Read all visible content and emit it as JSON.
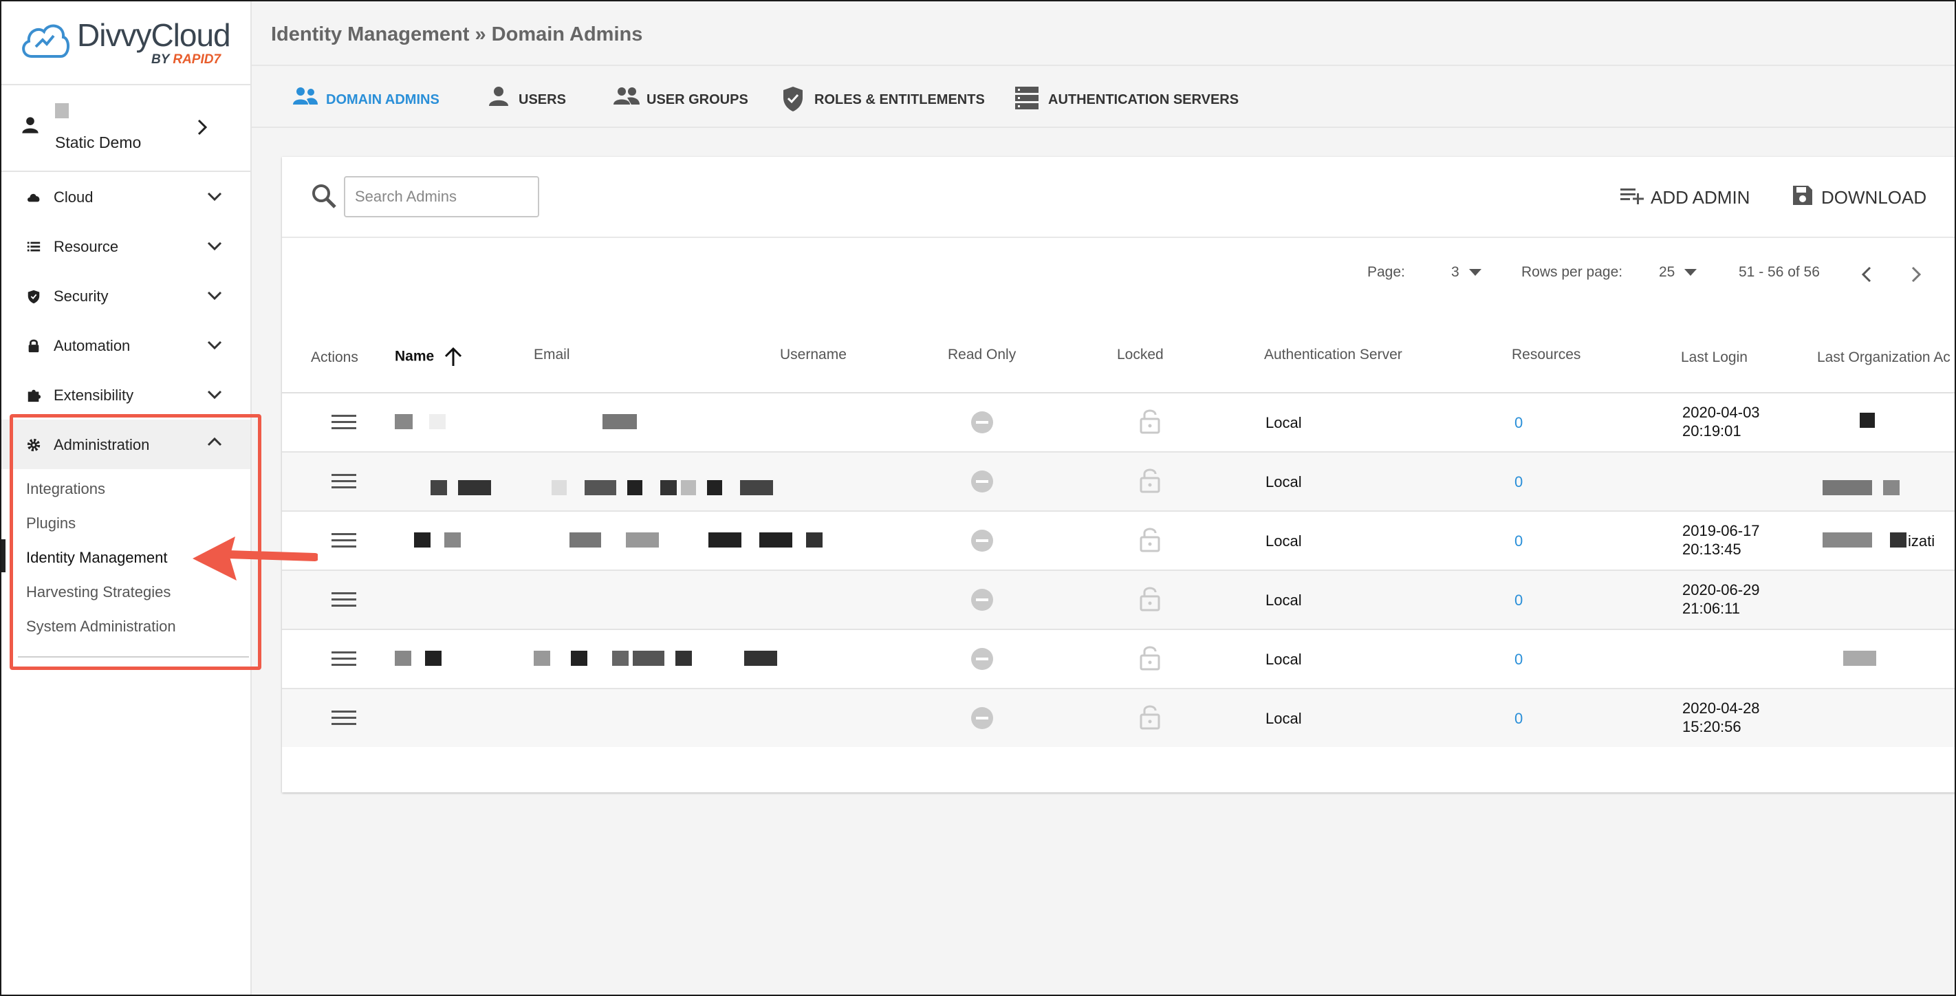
{
  "app": {
    "brand": "DivvyCloud",
    "by": "BY",
    "by_brand": "RAPID7"
  },
  "user": {
    "name": "Static Demo"
  },
  "nav": [
    {
      "label": "Cloud",
      "icon": "cloud-icon"
    },
    {
      "label": "Resource",
      "icon": "list-icon"
    },
    {
      "label": "Security",
      "icon": "shield-icon"
    },
    {
      "label": "Automation",
      "icon": "lock-icon"
    },
    {
      "label": "Extensibility",
      "icon": "puzzle-icon"
    },
    {
      "label": "Administration",
      "icon": "gear-icon",
      "expanded": true
    }
  ],
  "admin_sub": [
    "Integrations",
    "Plugins",
    "Identity Management",
    "Harvesting Strategies",
    "System Administration"
  ],
  "header": {
    "breadcrumb": "Identity Management » Domain Admins"
  },
  "tabs": [
    "DOMAIN ADMINS",
    "USERS",
    "USER GROUPS",
    "ROLES & ENTITLEMENTS",
    "AUTHENTICATION SERVERS"
  ],
  "toolbar": {
    "search_placeholder": "Search Admins",
    "add_label": "ADD ADMIN",
    "download_label": "DOWNLOAD"
  },
  "pager": {
    "page_label": "Page:",
    "page": "3",
    "rows_label": "Rows per page:",
    "rows": "25",
    "range": "51 - 56 of 56"
  },
  "columns": [
    "Actions",
    "Name",
    "Email",
    "Username",
    "Read Only",
    "Locked",
    "Authentication Server",
    "Resources",
    "Last Login",
    "Last Organization Ac"
  ],
  "rows": [
    {
      "auth": "Local",
      "resources": "0",
      "login_date": "2020-04-03",
      "login_time": "20:19:01",
      "org": ""
    },
    {
      "auth": "Local",
      "resources": "0",
      "login_date": "",
      "login_time": "",
      "org": ""
    },
    {
      "auth": "Local",
      "resources": "0",
      "login_date": "2019-06-17",
      "login_time": "20:13:45",
      "org": "izati"
    },
    {
      "auth": "Local",
      "resources": "0",
      "login_date": "2020-06-29",
      "login_time": "21:06:11",
      "org": ""
    },
    {
      "auth": "Local",
      "resources": "0",
      "login_date": "",
      "login_time": "",
      "org": ""
    },
    {
      "auth": "Local",
      "resources": "0",
      "login_date": "2020-04-28",
      "login_time": "15:20:56",
      "org": ""
    }
  ],
  "colors": {
    "accent": "#2a8fd8",
    "callout": "#ef5a48",
    "brand_orange": "#e85d2c"
  }
}
